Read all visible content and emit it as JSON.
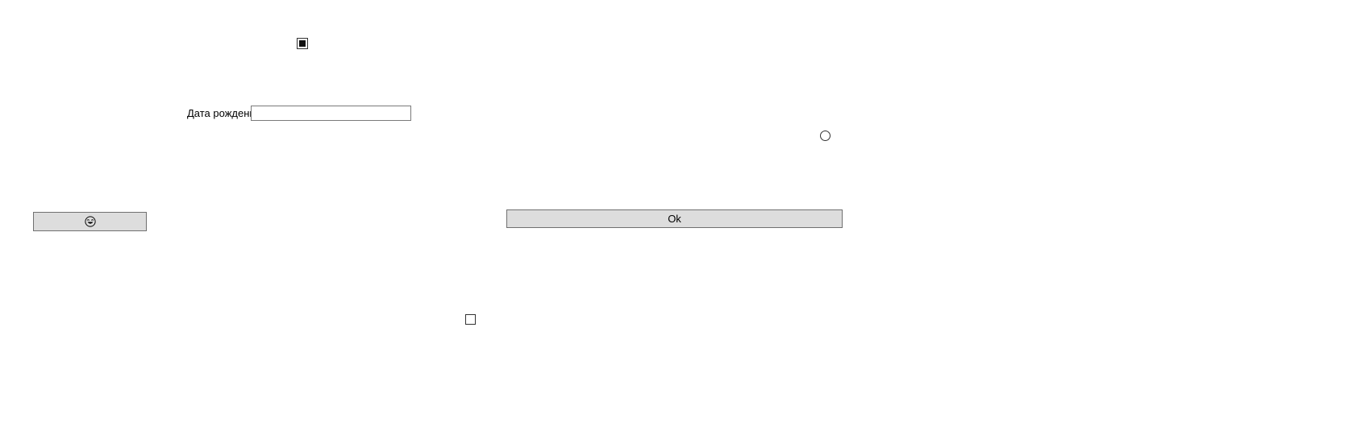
{
  "form": {
    "checkbox_top": {
      "checked": true
    },
    "birthdate": {
      "label": "Дата рождения",
      "value": "",
      "placeholder": ""
    },
    "radio_right": {
      "selected": false
    },
    "emoji_button": {
      "icon": "smiley-face-icon"
    },
    "ok_button": {
      "label": "Ok"
    },
    "checkbox_bottom": {
      "checked": false
    }
  }
}
